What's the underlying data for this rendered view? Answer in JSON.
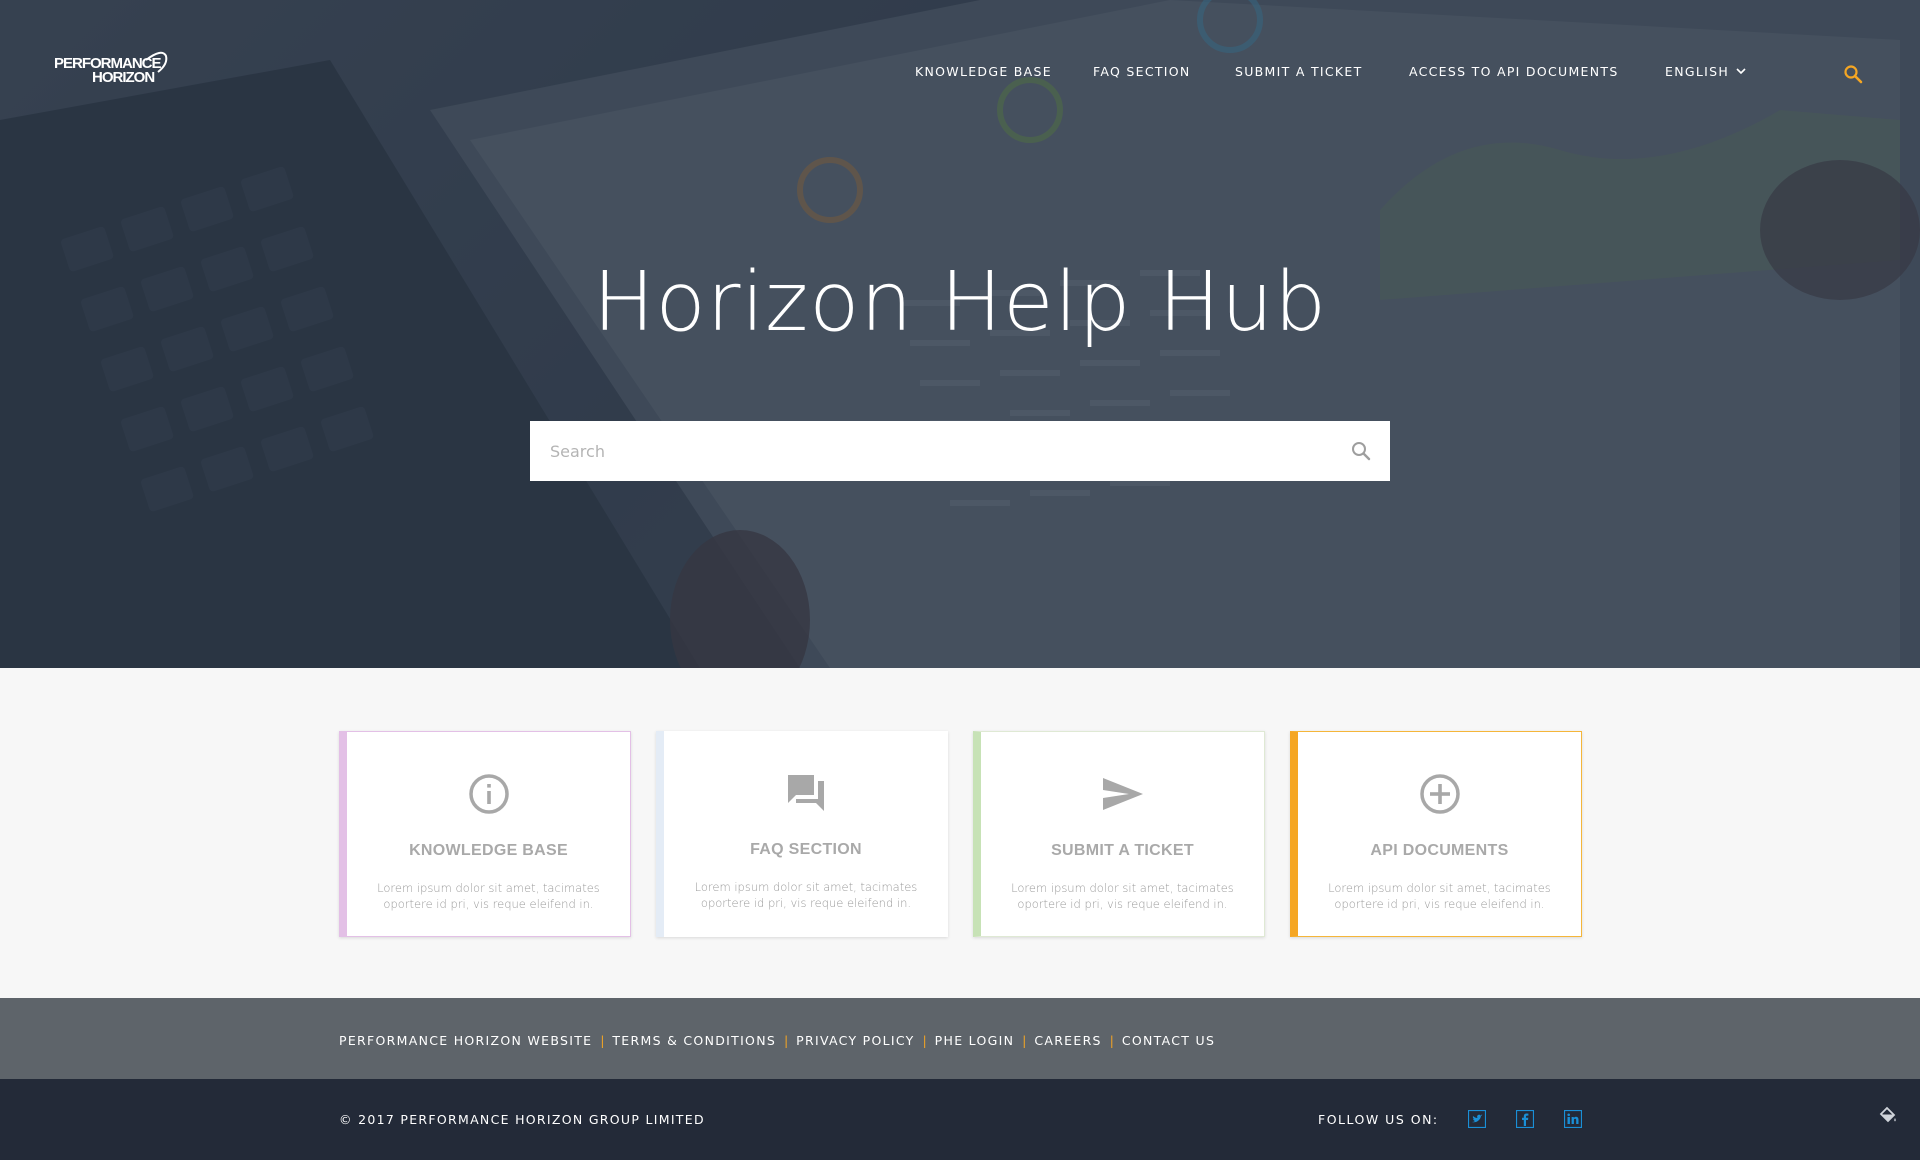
{
  "brand": {
    "logo_line1": "PERFORMANCE",
    "logo_line2": "HORIZON",
    "accent_color": "#f5a623"
  },
  "nav": {
    "items": [
      {
        "label": "KNOWLEDGE BASE"
      },
      {
        "label": "FAQ SECTION"
      },
      {
        "label": "SUBMIT A TICKET"
      },
      {
        "label": "ACCESS TO API DOCUMENTS"
      }
    ],
    "language": "ENGLISH",
    "language_icon": "chevron-down-icon",
    "search_icon": "search-icon"
  },
  "hero": {
    "title": "Horizon Help Hub",
    "search_placeholder": "Search",
    "search_value": ""
  },
  "cards": [
    {
      "title": "KNOWLEDGE BASE",
      "icon": "info-icon",
      "description": "Lorem ipsum dolor sit amet, tacimates oportere id pri, vis reque eleifend in.",
      "accent": "#e3c0e6"
    },
    {
      "title": "FAQ SECTION",
      "icon": "chat-bubbles-icon",
      "description": "Lorem ipsum dolor sit amet, tacimates oportere id pri, vis reque eleifend in.",
      "accent": "#e4ecf6"
    },
    {
      "title": "SUBMIT A TICKET",
      "icon": "send-icon",
      "description": "Lorem ipsum dolor sit amet, tacimates oportere id pri, vis reque eleifend in.",
      "accent": "#c7e2b6"
    },
    {
      "title": "API DOCUMENTS",
      "icon": "add-circle-icon",
      "description": "Lorem ipsum dolor sit amet, tacimates oportere id pri, vis reque eleifend in.",
      "accent": "#f5a623"
    }
  ],
  "footer": {
    "links": [
      "PERFORMANCE HORIZON WEBSITE",
      "TERMS & CONDITIONS",
      "PRIVACY POLICY",
      "PHE LOGIN",
      "CAREERS",
      "CONTACT US"
    ],
    "copyright": "© 2017 PERFORMANCE HORIZON GROUP LIMITED",
    "follow_label": "FOLLOW US ON:",
    "social": [
      "twitter-icon",
      "facebook-icon",
      "linkedin-icon"
    ],
    "social_color": "#1a8fd6"
  }
}
